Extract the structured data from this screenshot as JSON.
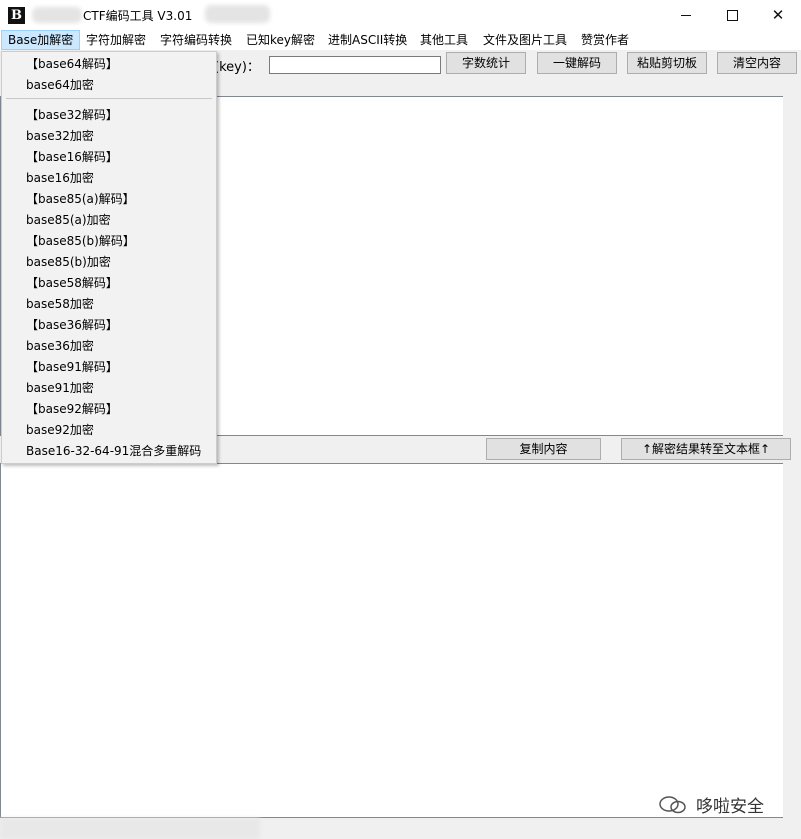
{
  "window": {
    "title": "CTF编码工具 V3.01",
    "controls": {
      "minimize": "",
      "maximize": "",
      "close": "✕"
    }
  },
  "menubar": [
    {
      "label": "Base加解密",
      "active": true
    },
    {
      "label": "字符加解密"
    },
    {
      "label": "字符编码转换"
    },
    {
      "label": "已知key解密"
    },
    {
      "label": "进制ASCII转换"
    },
    {
      "label": "其他工具"
    },
    {
      "label": "文件及图片工具"
    },
    {
      "label": "赞赏作者"
    }
  ],
  "toolbar": {
    "key_label": "(key)：",
    "key_value": "",
    "count_button": "字数统计",
    "decode_button": "一键解码",
    "paste_button": "粘贴剪切板",
    "clear_button": "清空内容"
  },
  "middle": {
    "copy_button": "复制内容",
    "move_button": "↑解密结果转至文本框↑"
  },
  "dropdown": [
    "【base64解码】",
    "base64加密",
    "【base32解码】",
    "base32加密",
    "【base16解码】",
    "base16加密",
    "【base85(a)解码】",
    "base85(a)加密",
    "【base85(b)解码】",
    "base85(b)加密",
    "【base58解码】",
    "base58加密",
    "【base36解码】",
    "base36加密",
    "【base91解码】",
    "base91加密",
    "【base92解码】",
    "base92加密",
    "Base16-32-64-91混合多重解码"
  ],
  "watermark": "哆啦安全"
}
